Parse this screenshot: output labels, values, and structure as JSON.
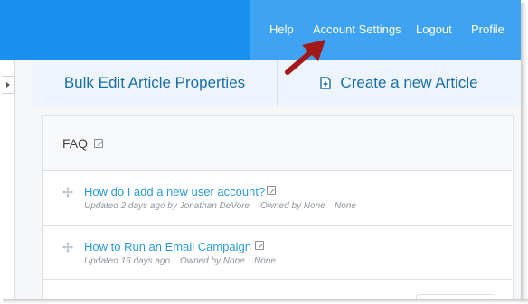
{
  "nav": {
    "help": "Help",
    "account_settings": "Account Settings",
    "logout": "Logout",
    "profile": "Profile"
  },
  "actions": {
    "bulk_edit": "Bulk Edit Article Properties",
    "create_new": "Create a new Article"
  },
  "category": {
    "title": "FAQ"
  },
  "articles": [
    {
      "title": "How do I add a new user account?",
      "meta": [
        "Updated 2 days ago by Jonathan DeVore",
        "Owned by None",
        "None"
      ]
    },
    {
      "title": "How to Run an Email Campaign",
      "meta": [
        "Updated 16 days ago",
        "Owned by None",
        "None"
      ]
    }
  ],
  "colors": {
    "topbar": "#1891f0",
    "topnav": "#3ea3f2",
    "link": "#2b9bd8",
    "action_text": "#1a6fa8",
    "annotation_arrow": "#a31919"
  },
  "icons": [
    "drag-handle-icon",
    "edit-icon",
    "new-document-icon",
    "collapse-arrow-icon",
    "annotation-arrow"
  ]
}
